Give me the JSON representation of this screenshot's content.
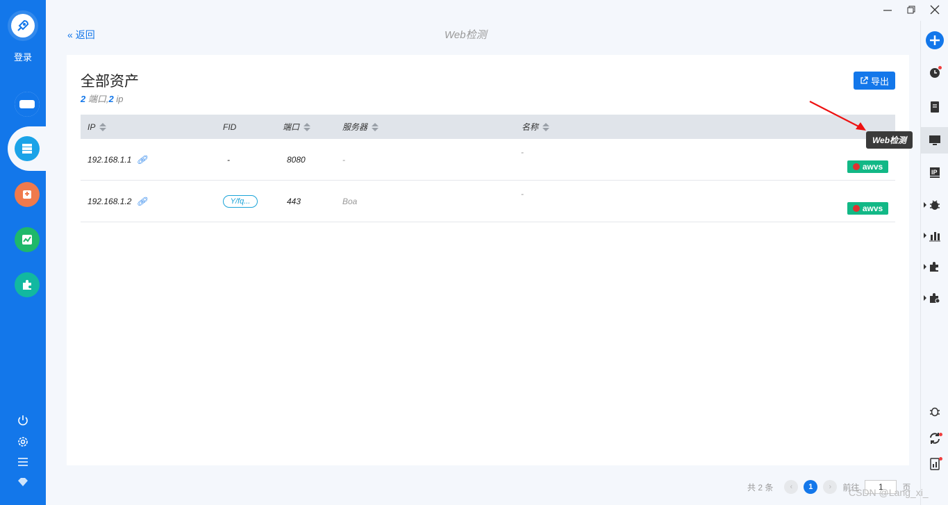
{
  "sidebar": {
    "login_label": "登录",
    "nav": [
      {
        "icon": "host-icon",
        "color": "#1377ea"
      },
      {
        "icon": "asset-list-icon",
        "color": "#1aa3e8",
        "active": true
      },
      {
        "icon": "vuln-icon",
        "color": "#f07a4c"
      },
      {
        "icon": "chart-icon",
        "color": "#1eb86a"
      },
      {
        "icon": "plugin-icon",
        "color": "#12b8a0"
      }
    ],
    "bottom": [
      "power-icon",
      "settings-icon",
      "menu-icon",
      "gem-icon"
    ]
  },
  "header": {
    "back_label": "返回",
    "title": "Web检测"
  },
  "card": {
    "title": "全部资产",
    "summary": {
      "ports_count": "2",
      "ports_label": " 端口,",
      "ip_count": "2",
      "ip_label": " ip"
    },
    "export_label": "导出"
  },
  "table": {
    "columns": [
      "IP",
      "FID",
      "端口",
      "服务器",
      "名称"
    ],
    "rows": [
      {
        "ip": "192.168.1.1",
        "fid": "-",
        "port": "8080",
        "server": "-",
        "name": "-",
        "tag": "awvs"
      },
      {
        "ip": "192.168.1.2",
        "fid": "Y/fq...",
        "port": "443",
        "server": "Boa",
        "name": "-",
        "tag": "awvs"
      }
    ]
  },
  "pagination": {
    "total": "共 2 条",
    "current_page": "1",
    "goto_label": "前往",
    "goto_value": "1",
    "page_suffix": "页"
  },
  "tooltip": "Web检测",
  "watermark": "CSDN @Lang_xi_"
}
